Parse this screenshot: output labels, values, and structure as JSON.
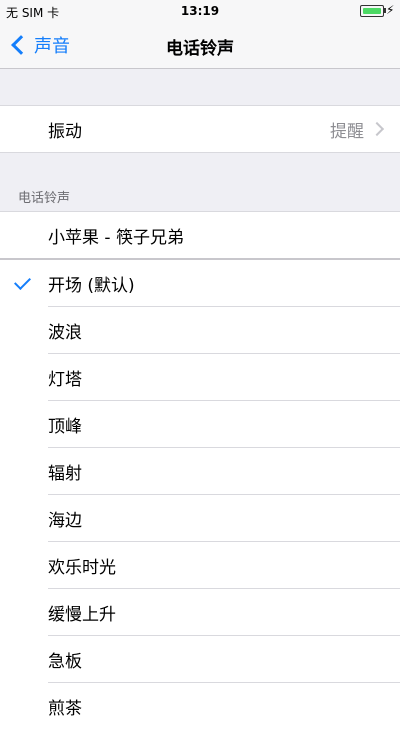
{
  "statusbar": {
    "carrier": "无 SIM 卡",
    "time": "13:19"
  },
  "nav": {
    "back_label": "声音",
    "title": "电话铃声"
  },
  "vibration": {
    "label": "振动",
    "value": "提醒"
  },
  "section_header": "电话铃声",
  "custom_ringtone": "小苹果 - 筷子兄弟",
  "ringtones": [
    {
      "label": "开场 (默认)",
      "checked": true
    },
    {
      "label": "波浪"
    },
    {
      "label": "灯塔"
    },
    {
      "label": "顶峰"
    },
    {
      "label": "辐射"
    },
    {
      "label": "海边"
    },
    {
      "label": "欢乐时光"
    },
    {
      "label": "缓慢上升"
    },
    {
      "label": "急板"
    },
    {
      "label": "煎茶"
    }
  ],
  "colors": {
    "accent": "#147efb",
    "background": "#efeff4"
  }
}
